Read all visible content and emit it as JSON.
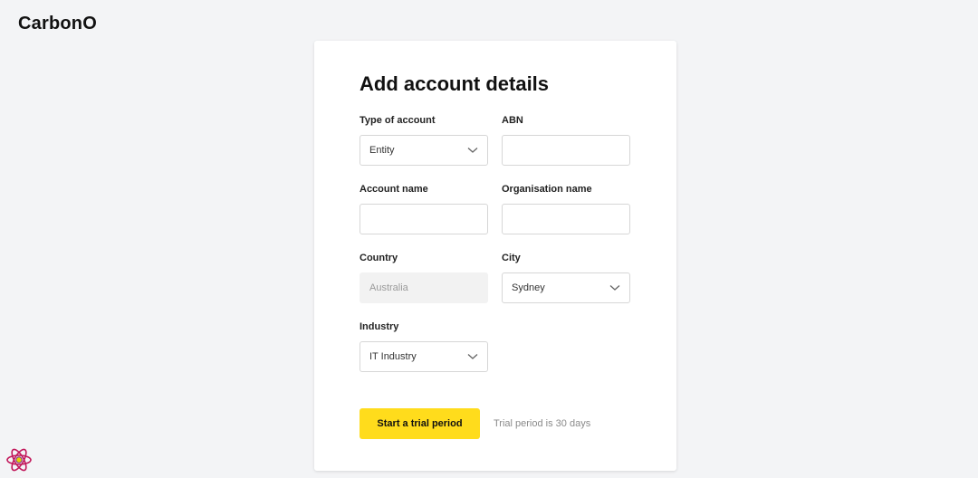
{
  "app": {
    "brand": "CarbonO"
  },
  "form": {
    "title": "Add account details",
    "account_type": {
      "label": "Type of account",
      "value": "Entity"
    },
    "abn": {
      "label": "ABN",
      "value": ""
    },
    "account_name": {
      "label": "Account name",
      "value": ""
    },
    "organisation_name": {
      "label": "Organisation name",
      "value": ""
    },
    "country": {
      "label": "Country",
      "value": "Australia"
    },
    "city": {
      "label": "City",
      "value": "Sydney"
    },
    "industry": {
      "label": "Industry",
      "value": "IT Industry"
    },
    "submit_label": "Start a trial period",
    "trial_note": "Trial period is 30 days"
  },
  "colors": {
    "accent": "#ffdc1c",
    "background": "#f3f4f6",
    "card": "#ffffff"
  },
  "icons": {
    "select_chevron": "chevron-down-icon",
    "dev_logo": "react-logo-icon"
  }
}
